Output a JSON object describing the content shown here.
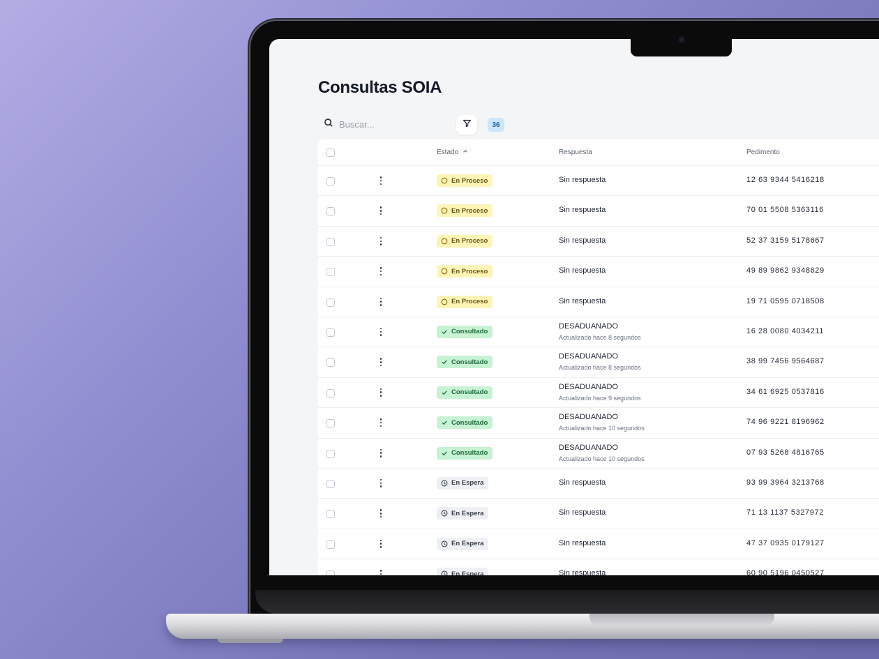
{
  "page": {
    "title": "Consultas SOIA"
  },
  "toolbar": {
    "search_placeholder": "Buscar...",
    "count": "36"
  },
  "table": {
    "headers": {
      "estado": "Estado",
      "respuesta": "Respuesta",
      "pedimento": "Pedimento"
    },
    "rows": [
      {
        "status": "En Proceso",
        "status_type": "proceso",
        "response": "Sin respuesta",
        "updated": "",
        "pedimento": "12 63 9344 5416218"
      },
      {
        "status": "En Proceso",
        "status_type": "proceso",
        "response": "Sin respuesta",
        "updated": "",
        "pedimento": "70 01 5508 5363116"
      },
      {
        "status": "En Proceso",
        "status_type": "proceso",
        "response": "Sin respuesta",
        "updated": "",
        "pedimento": "52 37 3159 5178667"
      },
      {
        "status": "En Proceso",
        "status_type": "proceso",
        "response": "Sin respuesta",
        "updated": "",
        "pedimento": "49 89 9862 9348629"
      },
      {
        "status": "En Proceso",
        "status_type": "proceso",
        "response": "Sin respuesta",
        "updated": "",
        "pedimento": "19 71 0595 0718508"
      },
      {
        "status": "Consultado",
        "status_type": "consultado",
        "response": "DESADUANADO",
        "updated": "Actualizado hace 8 segundos",
        "pedimento": "16 28 0080 4034211"
      },
      {
        "status": "Consultado",
        "status_type": "consultado",
        "response": "DESADUANADO",
        "updated": "Actualizado hace 8 segundos",
        "pedimento": "38 99 7456 9564687"
      },
      {
        "status": "Consultado",
        "status_type": "consultado",
        "response": "DESADUANADO",
        "updated": "Actualizado hace 9 segundos",
        "pedimento": "34 61 6925 0537816"
      },
      {
        "status": "Consultado",
        "status_type": "consultado",
        "response": "DESADUANADO",
        "updated": "Actualizado hace 10 segundos",
        "pedimento": "74 96 9221 8196962"
      },
      {
        "status": "Consultado",
        "status_type": "consultado",
        "response": "DESADUANADO",
        "updated": "Actualizado hace 10 segundos",
        "pedimento": "07 93 5268 4816765"
      },
      {
        "status": "En Espera",
        "status_type": "espera",
        "response": "Sin respuesta",
        "updated": "",
        "pedimento": "93 99 3964 3213768"
      },
      {
        "status": "En Espera",
        "status_type": "espera",
        "response": "Sin respuesta",
        "updated": "",
        "pedimento": "71 13 1137 5327972"
      },
      {
        "status": "En Espera",
        "status_type": "espera",
        "response": "Sin respuesta",
        "updated": "",
        "pedimento": "47 37 0935 0179127"
      },
      {
        "status": "En Espera",
        "status_type": "espera",
        "response": "Sin respuesta",
        "updated": "",
        "pedimento": "60 90 5196 0450527"
      }
    ]
  },
  "icons": {
    "search": "search-icon",
    "filter": "filter-icon",
    "sort": "chevron-up-icon",
    "proceso": "circle-icon",
    "consultado": "check-icon",
    "espera": "clock-icon",
    "row_menu": "kebab-menu-icon"
  },
  "colors": {
    "proceso_bg": "#fdf4b8",
    "consultado_bg": "#c7f2d3",
    "espera_bg": "#eef0f3",
    "count_badge_bg": "#cde6fb"
  }
}
